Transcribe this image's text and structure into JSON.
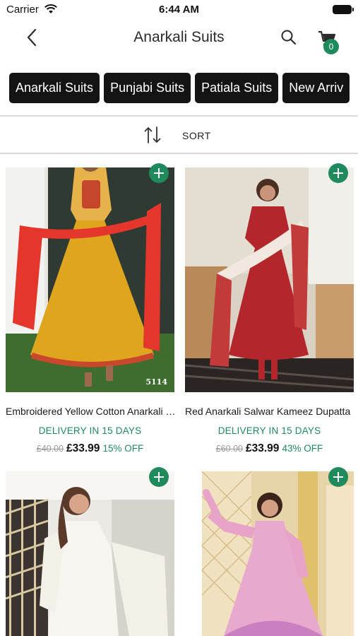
{
  "status_bar": {
    "carrier": "Carrier",
    "time": "6:44 AM"
  },
  "nav": {
    "title": "Anarkali Suits",
    "cart_count": "0"
  },
  "categories": [
    "Anarkali Suits",
    "Punjabi Suits",
    "Patiala Suits",
    "New Arriv"
  ],
  "sort": {
    "label": "SORT"
  },
  "products": [
    {
      "name": "Embroidered Yellow Cotton Anarkali Suit",
      "delivery": "DELIVERY IN 15 DAYS",
      "old_price": "£40.00",
      "price": "£33.99",
      "discount": "15% OFF",
      "sku_label": "5114"
    },
    {
      "name": "Red Anarkali Salwar Kameez Dupatta",
      "delivery": "DELIVERY IN 15 DAYS",
      "old_price": "£60.00",
      "price": "£33.99",
      "discount": "43% OFF"
    },
    {
      "name": "",
      "delivery": "",
      "old_price": "",
      "price": "",
      "discount": ""
    },
    {
      "name": "",
      "delivery": "",
      "old_price": "",
      "price": "",
      "discount": ""
    }
  ],
  "colors": {
    "accent": "#1f8a5b",
    "chip_bg": "#141414"
  }
}
